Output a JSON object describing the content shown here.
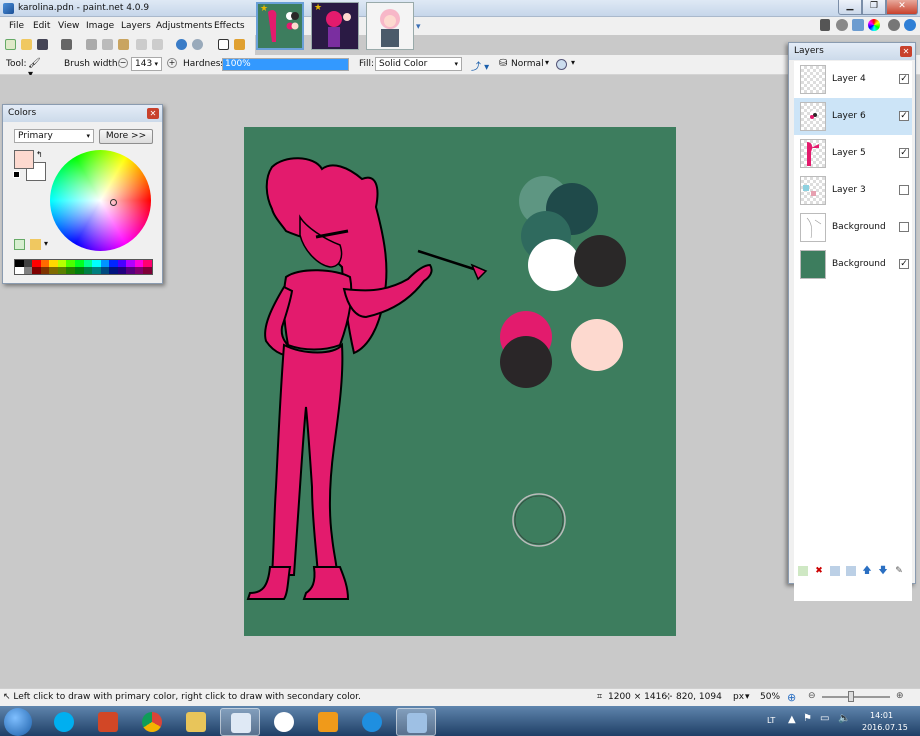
{
  "window": {
    "title": "karolina.pdn - paint.net 4.0.9"
  },
  "menu": [
    "File",
    "Edit",
    "View",
    "Image",
    "Layers",
    "Adjustments",
    "Effects"
  ],
  "toolbar": {
    "tool_label": "Tool:",
    "brush_width_label": "Brush width:",
    "brush_width_value": "143",
    "hardness_label": "Hardness:",
    "hardness_value": "100%",
    "hardness_fraction": 1.0,
    "fill_label": "Fill:",
    "fill_value": "Solid Color",
    "blend_value": "Normal"
  },
  "colors_panel": {
    "title": "Colors",
    "mode_select": "Primary",
    "more_button": "More >>",
    "primary_color": "#fdd9cf",
    "secondary_color": "#ffffff",
    "palette": [
      "#000000",
      "#404040",
      "#ff0000",
      "#ff6a00",
      "#ffd800",
      "#b6ff00",
      "#4cff00",
      "#00ff21",
      "#00ff90",
      "#00ffff",
      "#0094ff",
      "#0026ff",
      "#4800ff",
      "#b200ff",
      "#ff00dc",
      "#ff006e",
      "#ffffff",
      "#808080",
      "#7f0000",
      "#7f3300",
      "#7f6a00",
      "#5b7f00",
      "#267f00",
      "#007f0e",
      "#007f46",
      "#007f7f",
      "#004a7f",
      "#00137f",
      "#21007f",
      "#57007f",
      "#7f006e",
      "#7f0037"
    ]
  },
  "layers_panel": {
    "title": "Layers",
    "layers": [
      {
        "name": "Layer 4",
        "checked": true,
        "selected": false
      },
      {
        "name": "Layer 6",
        "checked": true,
        "selected": true
      },
      {
        "name": "Layer 5",
        "checked": true,
        "selected": false
      },
      {
        "name": "Layer 3",
        "checked": false,
        "selected": false
      },
      {
        "name": "Background",
        "checked": false,
        "selected": false
      },
      {
        "name": "Background",
        "checked": true,
        "selected": false
      }
    ]
  },
  "canvas": {
    "background_color": "#3d7d5e",
    "swatch_colors": [
      "#5e9682",
      "#1f4a4a",
      "#2f6a5e",
      "#ffffff",
      "#2a2828",
      "#e31b6d",
      "#2a2628",
      "#fdd9cf"
    ],
    "figure_color": "#e31b6d"
  },
  "status": {
    "hint": "Left click to draw with primary color, right click to draw with secondary color.",
    "image_size": "1200 × 1416",
    "cursor_position": "820, 1094",
    "units": "px",
    "zoom": "50%"
  },
  "taskbar": {
    "language": "LT",
    "time": "14:01",
    "date": "2016.07.15"
  }
}
